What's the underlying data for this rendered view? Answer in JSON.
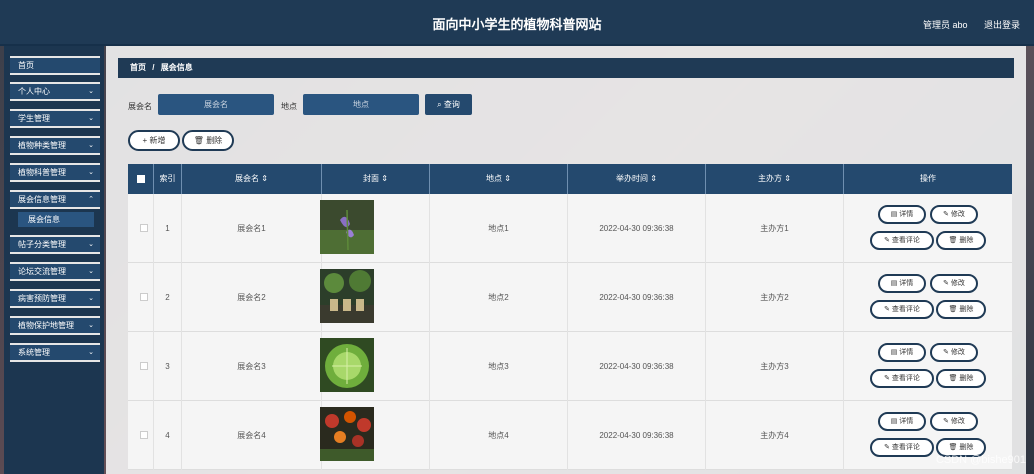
{
  "header": {
    "title": "面向中小学生的植物科普网站",
    "user": "管理员 abo",
    "logout": "退出登录"
  },
  "sidebar": {
    "items": [
      {
        "label": "首页",
        "chev": ""
      },
      {
        "label": "个人中心",
        "chev": "⌄"
      },
      {
        "label": "学生管理",
        "chev": "⌄"
      },
      {
        "label": "植物种类管理",
        "chev": "⌄"
      },
      {
        "label": "植物科普管理",
        "chev": "⌄"
      },
      {
        "label": "展会信息管理",
        "chev": "⌃"
      },
      {
        "label": "帖子分类管理",
        "chev": "⌄"
      },
      {
        "label": "论坛交流管理",
        "chev": "⌄"
      },
      {
        "label": "病害预防管理",
        "chev": "⌄"
      },
      {
        "label": "植物保护地管理",
        "chev": "⌄"
      },
      {
        "label": "系统管理",
        "chev": "⌄"
      }
    ],
    "sub_item": "展会信息"
  },
  "breadcrumb": {
    "home": "首页",
    "sep": "/",
    "current": "展会信息"
  },
  "search": {
    "name_label": "展会名",
    "name_placeholder": "展会名",
    "place_label": "地点",
    "place_placeholder": "地点",
    "button": "查询"
  },
  "toolbar": {
    "add": "新增",
    "delete": "删除"
  },
  "table": {
    "headers": [
      "",
      "索引",
      "展会名 ⇕",
      "封面 ⇕",
      "地点 ⇕",
      "举办时间 ⇕",
      "主办方 ⇕",
      "操作"
    ],
    "rows": [
      {
        "index": "1",
        "name": "展会名1",
        "place": "地点1",
        "time": "2022-04-30 09:36:38",
        "host": "主办方1"
      },
      {
        "index": "2",
        "name": "展会名2",
        "place": "地点2",
        "time": "2022-04-30 09:36:38",
        "host": "主办方2"
      },
      {
        "index": "3",
        "name": "展会名3",
        "place": "地点3",
        "time": "2022-04-30 09:36:38",
        "host": "主办方3"
      },
      {
        "index": "4",
        "name": "展会名4",
        "place": "地点4",
        "time": "2022-04-30 09:36:38",
        "host": "主办方4"
      }
    ],
    "actions": {
      "detail": "详情",
      "edit": "修改",
      "comments": "查看评论",
      "delete": "删除"
    }
  },
  "watermark": "CSDN @bishe901",
  "colors": {
    "header": "#1f3a55",
    "accent": "#24496e",
    "input": "#2a5580"
  }
}
